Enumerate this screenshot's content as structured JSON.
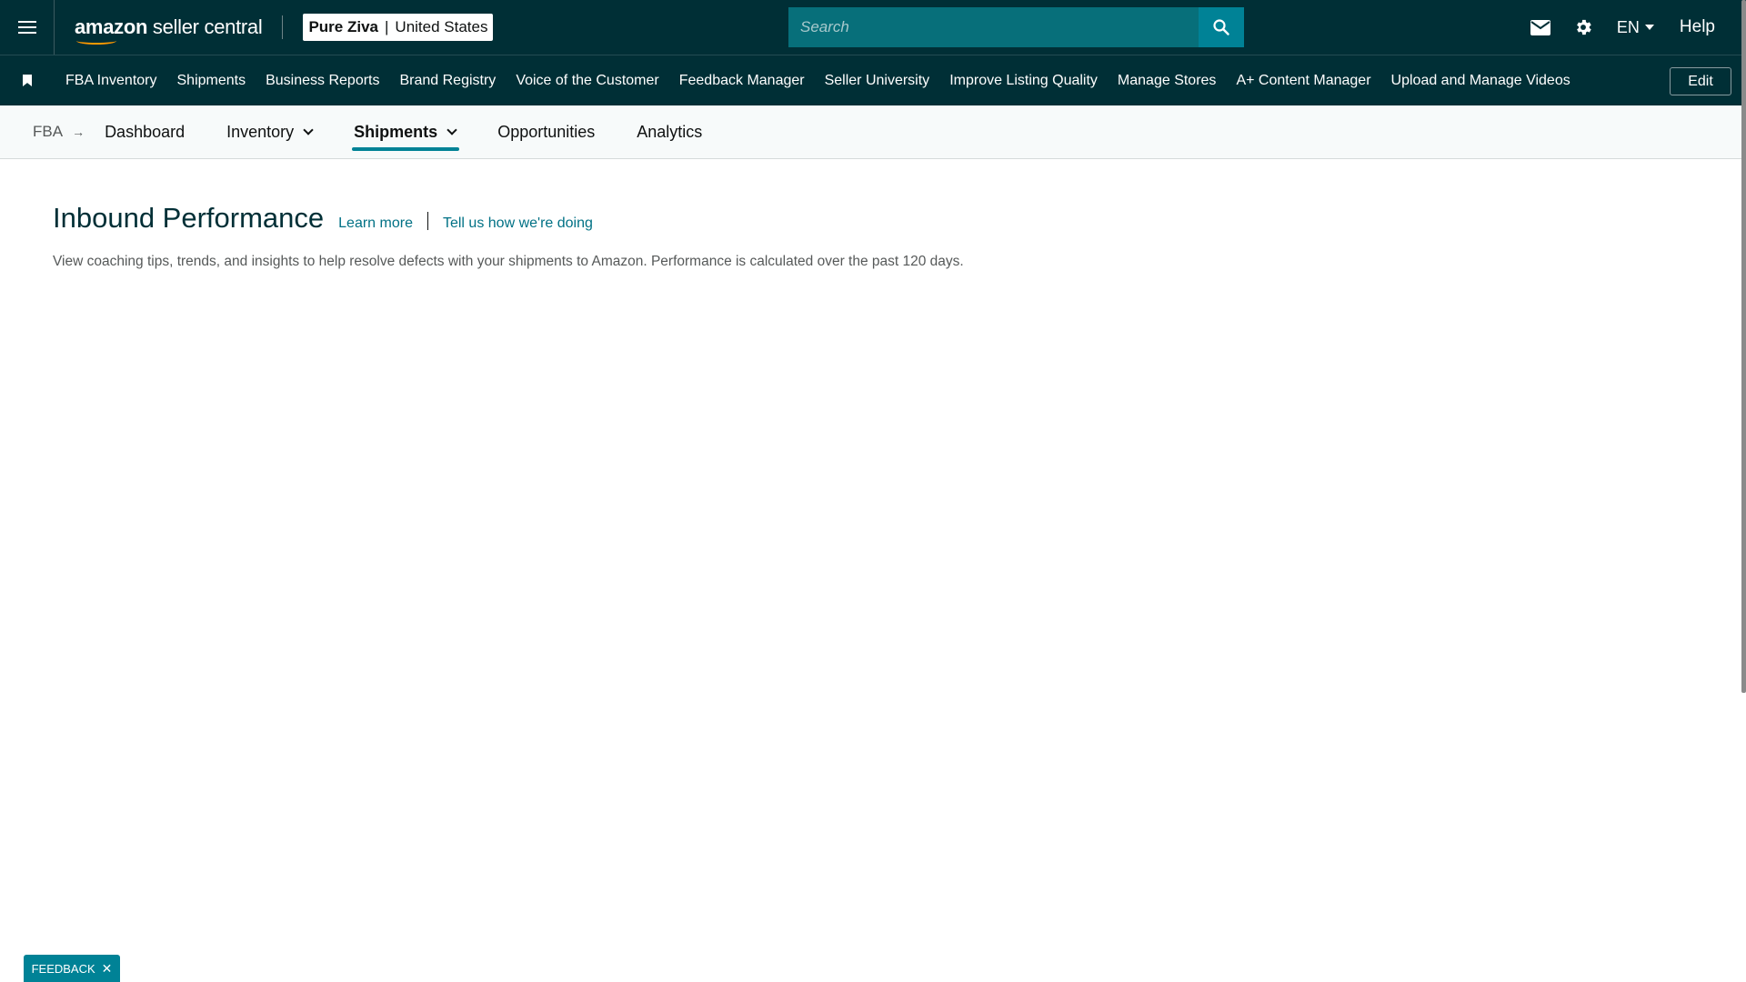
{
  "topbar": {
    "logo_brand": "amazon",
    "logo_product": " seller central",
    "store_name": "Pure Ziva",
    "store_separator": "|",
    "store_region": "United States",
    "search_placeholder": "Search",
    "language": "EN",
    "help_label": "Help",
    "icons": [
      "menu-icon",
      "search-icon",
      "mail-icon",
      "gear-icon"
    ]
  },
  "navbar": {
    "links": [
      "FBA Inventory",
      "Shipments",
      "Business Reports",
      "Brand Registry",
      "Voice of the Customer",
      "Feedback Manager",
      "Seller University",
      "Improve Listing Quality",
      "Manage Stores",
      "A+ Content Manager",
      "Upload and Manage Videos"
    ],
    "edit_label": "Edit"
  },
  "subnav": {
    "breadcrumb": "FBA",
    "breadcrumb_arrow": "→",
    "tabs": [
      "Dashboard",
      "Inventory",
      "Shipments",
      "Opportunities",
      "Analytics"
    ],
    "active_tab": "Shipments"
  },
  "main": {
    "title": "Inbound Performance",
    "learn_more": "Learn more",
    "feedback_link": "Tell us how we're doing",
    "description": "View coaching tips, trends, and insights to help resolve defects with your shipments to Amazon. Performance is calculated over the past 120 days."
  },
  "feedback_tab": {
    "label": "FEEDBACK",
    "close": "✕"
  },
  "colors": {
    "header_bg": "#002f36",
    "accent": "#008296",
    "link": "#007185"
  }
}
